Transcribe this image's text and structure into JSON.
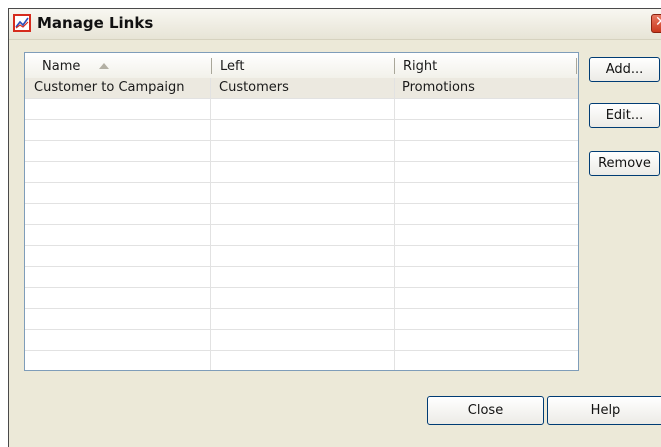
{
  "window": {
    "title": "Manage Links",
    "app_icon": "chart-line-icon",
    "close_icon": "close-icon",
    "close_glyph": "✕",
    "accent_color": "#d62b1d"
  },
  "table": {
    "columns": [
      "Name",
      "Left",
      "Right"
    ],
    "sort_column": "Name",
    "sort_direction": "ascending",
    "rows": [
      [
        "Customer to Campaign",
        "Customers",
        "Promotions"
      ]
    ],
    "selected_row": 0
  },
  "buttons": {
    "add": "Add...",
    "edit": "Edit...",
    "remove": "Remove",
    "close": "Close",
    "help": "Help"
  }
}
